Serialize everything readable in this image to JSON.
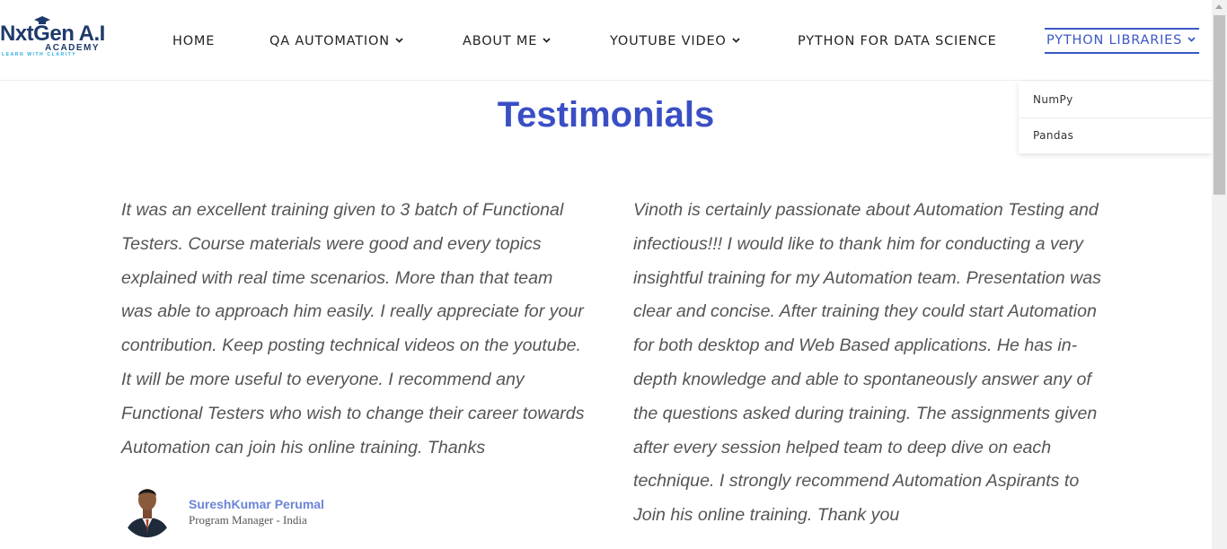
{
  "logo": {
    "main": "NxtGen A.I",
    "sub": "ACADEMY",
    "tagline": "LEARN WITH CLARITY"
  },
  "nav": {
    "items": [
      {
        "label": "HOME",
        "has_dropdown": false
      },
      {
        "label": "QA AUTOMATION",
        "has_dropdown": true
      },
      {
        "label": "ABOUT ME",
        "has_dropdown": true
      },
      {
        "label": "YOUTUBE VIDEO",
        "has_dropdown": true
      },
      {
        "label": "PYTHON FOR DATA SCIENCE",
        "has_dropdown": false
      },
      {
        "label": "PYTHON LIBRARIES",
        "has_dropdown": true,
        "active": true
      }
    ],
    "dropdown": [
      "NumPy",
      "Pandas"
    ]
  },
  "page": {
    "title": "Testimonials"
  },
  "testimonials": [
    {
      "text": "It was an excellent training given to 3 batch of Functional Testers. Course materials were good and every topics explained with real time scenarios. More than that team was able to approach him easily. I really appreciate for your contribution. Keep posting technical videos on the youtube. It will be more useful to everyone. I recommend any Functional Testers who wish to change their career towards Automation can join his online training. Thanks",
      "author": "SureshKumar Perumal",
      "role": "Program Manager - India"
    },
    {
      "text": "Vinoth is certainly passionate about Automation Testing and infectious!!! I would like to thank him for conducting a very insightful training for my Automation team. Presentation was clear and concise. After training they could start Automation for both desktop and Web Based applications. He has in-depth knowledge and able to spontaneously answer any of the questions asked during training. The assignments given after every session helped team to deep dive on each technique. I strongly recommend Automation Aspirants to Join his online training. Thank you"
    }
  ],
  "colors": {
    "accent": "#3a4fc4",
    "nav_active": "#3a58c4",
    "author_name": "#6b84d6",
    "logo_dark": "#1e3a6b",
    "logo_light": "#29a8e0"
  }
}
